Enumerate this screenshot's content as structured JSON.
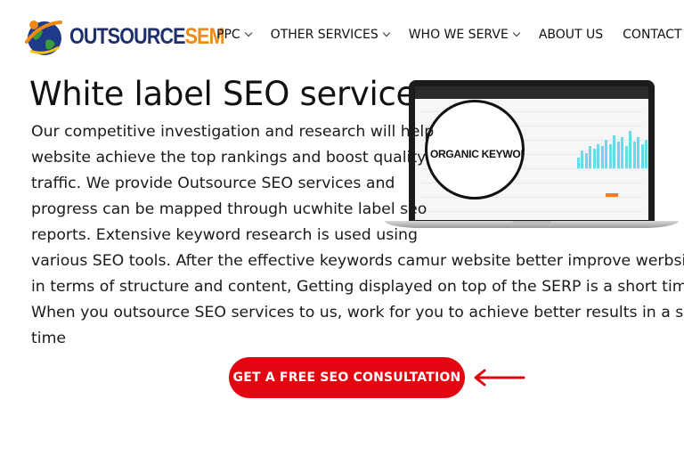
{
  "brand": {
    "logo_part1": "OUTSOURCE",
    "logo_part2": "SEM",
    "colors": {
      "navy": "#1f2f6a",
      "orange": "#f08a16"
    }
  },
  "nav": {
    "items": [
      {
        "label": "PPC",
        "dropdown": true
      },
      {
        "label": "OTHER SERVICES",
        "dropdown": true
      },
      {
        "label": "WHO WE SERVE",
        "dropdown": true
      },
      {
        "label": "ABOUT US",
        "dropdown": false
      },
      {
        "label": "CONTACT US",
        "dropdown": false
      }
    ]
  },
  "hero": {
    "title": "White label SEO services",
    "paragraph_lines": [
      "Our competitive investigation and research will help",
      "website achieve the top rankings and boost quality",
      "traffic. We provide Outsource SEO services and",
      "progress can be mapped through ucwhite label seo",
      "reports. Extensive keyword research is used using",
      "various SEO tools. After the effective keywords camur website better improve werbsin",
      "in terms of structure and content, Getting displayed on top of the SERP is a short time",
      "When you outsource SEO services to us, work for you to achieve better results in a short",
      "time"
    ]
  },
  "illustration": {
    "magnifier_text": "ORGANIC KEYWORD",
    "bar_heights": [
      0.25,
      0.4,
      0.35,
      0.5,
      0.45,
      0.55,
      0.5,
      0.65,
      0.55,
      0.75,
      0.6,
      0.7,
      0.5,
      0.85,
      0.6,
      0.7,
      0.55,
      0.65,
      0.8,
      0.6,
      0.9
    ]
  },
  "cta": {
    "label": "GET A FREE SEO CONSULTATION",
    "color": "#e30611"
  }
}
